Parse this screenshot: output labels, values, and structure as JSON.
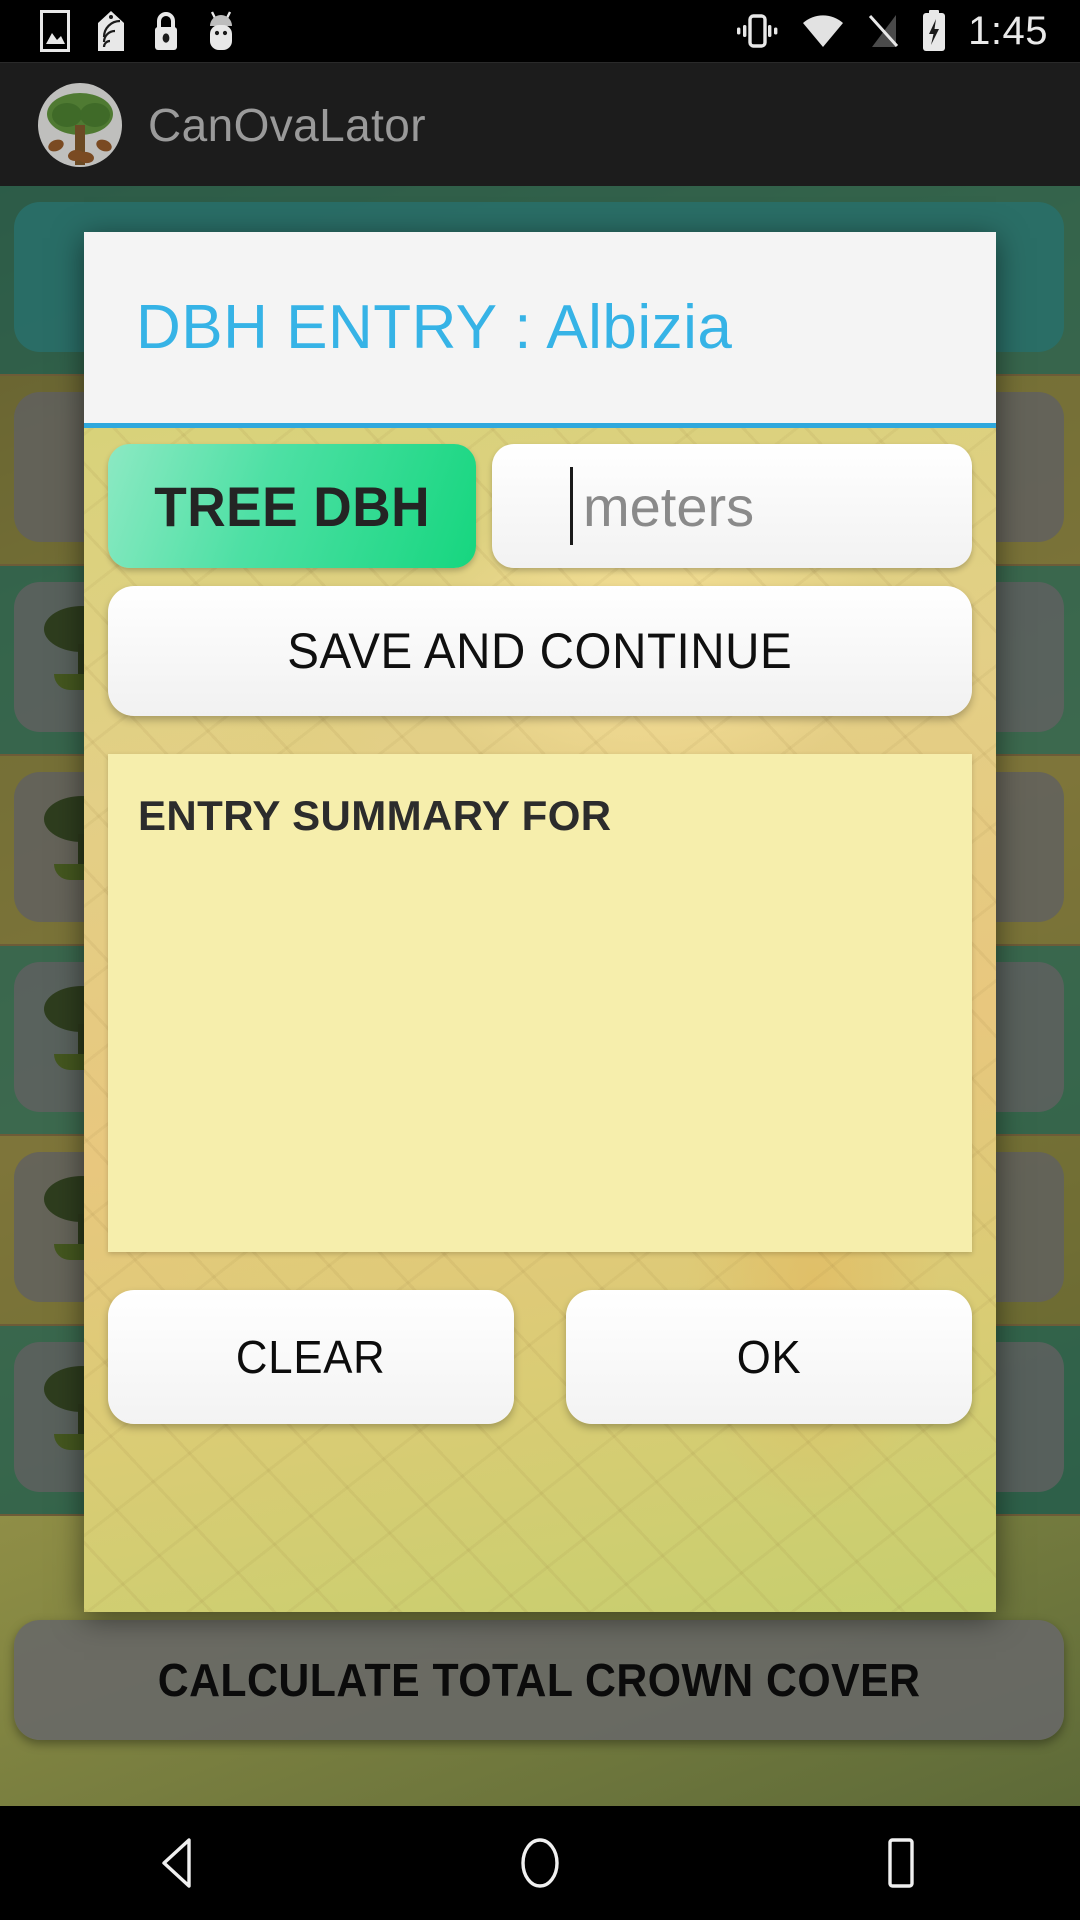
{
  "status_bar": {
    "clock": "1:45",
    "left_icons": [
      "photo-icon",
      "nfc-icon",
      "lock-icon",
      "android-icon"
    ],
    "right_icons": [
      "vibrate-icon",
      "wifi-icon",
      "signal-off-icon",
      "battery-charging-icon"
    ]
  },
  "app_bar": {
    "title": "CanOvaLator",
    "logo": "cocoa-tree-logo-icon"
  },
  "dialog": {
    "title": "DBH ENTRY : Albizia",
    "dbh_button_label": "TREE DBH",
    "input": {
      "value": "",
      "placeholder": "meters"
    },
    "save_label": "SAVE AND CONTINUE",
    "summary": {
      "heading": "ENTRY SUMMARY FOR",
      "body": ""
    },
    "clear_label": "CLEAR",
    "ok_label": "OK"
  },
  "background": {
    "calculate_label": "CALCULATE TOTAL CROWN COVER",
    "rows": [
      {
        "style": "teal",
        "chip": "tealchip",
        "tree": false
      },
      {
        "style": "olive",
        "chip": "graychip",
        "tree": false
      },
      {
        "style": "teal",
        "chip": "none",
        "tree": true
      },
      {
        "style": "olive",
        "chip": "none",
        "tree": true
      },
      {
        "style": "teal",
        "chip": "none",
        "tree": true
      },
      {
        "style": "olive",
        "chip": "none",
        "tree": true
      },
      {
        "style": "teal",
        "chip": "none",
        "tree": true
      }
    ]
  },
  "nav_bar": {
    "back": "back-triangle-icon",
    "home": "home-circle-icon",
    "recents": "recents-square-icon"
  },
  "colors": {
    "accent_blue": "#36b3e6",
    "divider_blue": "#2fa8dd",
    "green_button": "#16d67f",
    "summary_yellow": "#f6eeac",
    "appbar_bg": "#1c1c1c"
  }
}
